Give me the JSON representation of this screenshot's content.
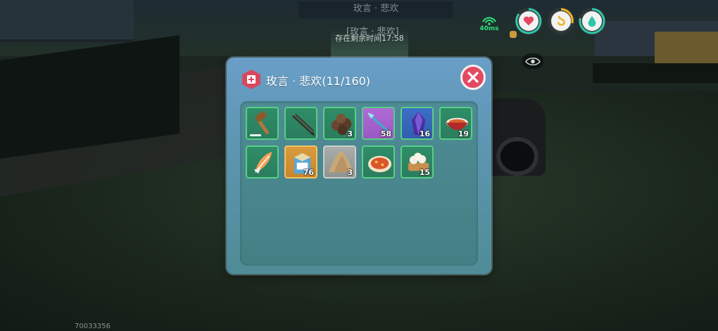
{
  "hud": {
    "container_title": "玫言 · 悲欢",
    "world_title": "[玫言 · 悲欢]",
    "countdown": "存在剩余时间17:58",
    "ping": "40ms",
    "player_id": "70033356",
    "colors": {
      "health": "#e84563",
      "hunger": "#f0b429",
      "thirst": "#2ec6a8",
      "ping": "#2fe07a"
    }
  },
  "panel": {
    "title": "玫言 · 悲欢(11/160)",
    "close_icon": "close-x-icon",
    "colors": {
      "close": "#e24a62",
      "slot_border": "#57d085"
    }
  },
  "slots": [
    {
      "name": "hammer",
      "qty": ""
    },
    {
      "name": "arrows",
      "qty": ""
    },
    {
      "name": "ore",
      "qty": "3"
    },
    {
      "name": "spear",
      "qty": "58"
    },
    {
      "name": "crystal",
      "qty": "16"
    },
    {
      "name": "rice-bowl",
      "qty": "19"
    },
    {
      "name": "feather",
      "qty": ""
    },
    {
      "name": "milk-carton",
      "qty": "76"
    },
    {
      "name": "sand-pile",
      "qty": "3"
    },
    {
      "name": "pizza",
      "qty": ""
    },
    {
      "name": "dumplings",
      "qty": "15"
    }
  ]
}
